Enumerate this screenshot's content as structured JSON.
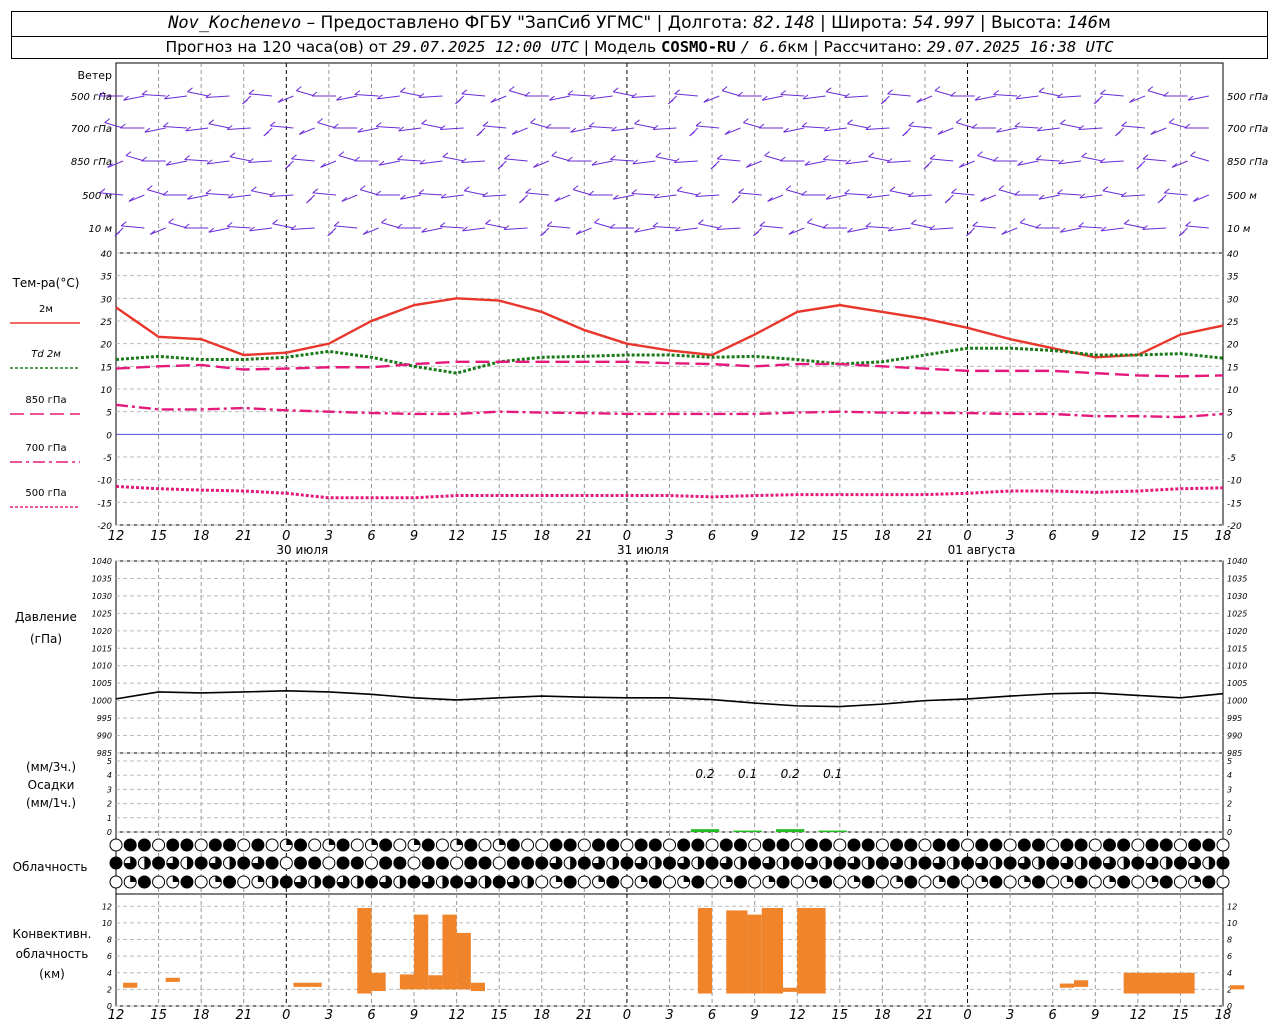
{
  "header": {
    "station": "Nov_Kochenevo",
    "provider": "– Предоставлено ФГБУ \"ЗапСиб УГМС\"",
    "lon_label": "Долгота:",
    "lon": "82.148",
    "lat_label": "Широта:",
    "lat": "54.997",
    "alt_label": "Высота:",
    "alt": "146",
    "alt_unit": "м",
    "forecast_prefix": "Прогноз на 120 часа(ов) от",
    "forecast_from": "29.07.2025 12:00 UTC",
    "model_label": "Модель",
    "model": "COSMO-RU",
    "resolution": "/ 6.6",
    "resolution_unit": "км",
    "calc_label": "Рассчитано:",
    "calc_time": "29.07.2025 16:38 UTC"
  },
  "chart_data": [
    {
      "type": "wind-barbs",
      "panel_title": "Ветер",
      "levels": [
        "500 гПа",
        "700 гПа",
        "850 гПа",
        "500 м",
        "10 м"
      ]
    },
    {
      "type": "line",
      "panel_title": "Тем-ра(°C)",
      "ylim": [
        -20,
        40
      ],
      "yticks": [
        40,
        35,
        30,
        25,
        20,
        15,
        10,
        5,
        0,
        -5,
        -10,
        -15,
        -20
      ],
      "x_hours": [
        0,
        3,
        6,
        9,
        12,
        15,
        18,
        21,
        24,
        27,
        30,
        33,
        36,
        39,
        42,
        45,
        48,
        51,
        54,
        57,
        60,
        63,
        66,
        69,
        72,
        75,
        78
      ],
      "series": [
        {
          "name": "2м",
          "color": "#e8362c",
          "style": "solid",
          "values": [
            28,
            21.5,
            21,
            17.5,
            18,
            20,
            25,
            28.5,
            30,
            29.5,
            27,
            23,
            20,
            18.5,
            17.5,
            22,
            27,
            28.5,
            27,
            25.5,
            23.5,
            21,
            19,
            17,
            17.5,
            22,
            24
          ]
        },
        {
          "name": "Td 2м",
          "color": "#1a7a1a",
          "style": "dotted",
          "values": [
            16.5,
            17.2,
            16.5,
            16.5,
            17,
            18.3,
            17,
            15,
            13.5,
            16,
            17,
            17.2,
            17.5,
            17.5,
            17,
            17.2,
            16.5,
            15.5,
            16,
            17.5,
            19,
            19,
            18.5,
            17.5,
            17.5,
            17.8,
            16.8
          ]
        },
        {
          "name": "850 гПа",
          "color": "#e4197c",
          "style": "longdash",
          "values": [
            14.5,
            15,
            15.3,
            14.3,
            14.5,
            14.8,
            14.8,
            15.5,
            16,
            16,
            16,
            16,
            16,
            15.7,
            15.5,
            15,
            15.5,
            15.5,
            15,
            14.5,
            14,
            14,
            14,
            13.5,
            13,
            12.8,
            13
          ]
        },
        {
          "name": "700 гПа",
          "color": "#e4197c",
          "style": "dashdot",
          "values": [
            6.5,
            5.5,
            5.5,
            5.8,
            5.3,
            5,
            4.7,
            4.5,
            4.5,
            5,
            4.8,
            4.7,
            4.5,
            4.5,
            4.5,
            4.5,
            4.8,
            5,
            4.8,
            4.7,
            4.7,
            4.5,
            4.5,
            4,
            4,
            3.8,
            4.5
          ]
        },
        {
          "name": "500 гПа",
          "color": "#e4197c",
          "style": "dotted",
          "values": [
            -11.5,
            -12,
            -12.3,
            -12.5,
            -13,
            -14,
            -14,
            -14,
            -13.5,
            -13.5,
            -13.5,
            -13.5,
            -13.5,
            -13.5,
            -13.8,
            -13.5,
            -13.3,
            -13.3,
            -13.3,
            -13.3,
            -13,
            -12.5,
            -12.5,
            -12.8,
            -12.5,
            -12,
            -11.8
          ]
        }
      ]
    },
    {
      "type": "line",
      "panel_title": "Давление",
      "unit": "(гПа)",
      "ylim": [
        985,
        1040
      ],
      "yticks": [
        1040,
        1035,
        1030,
        1025,
        1020,
        1015,
        1010,
        1005,
        1000,
        995,
        990,
        985
      ],
      "x_hours": [
        0,
        3,
        6,
        9,
        12,
        15,
        18,
        21,
        24,
        27,
        30,
        33,
        36,
        39,
        42,
        45,
        48,
        51,
        54,
        57,
        60,
        63,
        66,
        69,
        72,
        75,
        78
      ],
      "series": [
        {
          "color": "#000000",
          "values": [
            1000.5,
            1002.5,
            1002.2,
            1002.5,
            1002.8,
            1002.5,
            1001.8,
            1000.8,
            1000.2,
            1000.8,
            1001.3,
            1001,
            1000.8,
            1000.8,
            1000.3,
            999.3,
            998.5,
            998.3,
            999,
            1000,
            1000.5,
            1001.3,
            1002,
            1002.2,
            1001.5,
            1000.8,
            1002
          ]
        }
      ]
    },
    {
      "type": "bar",
      "panel_title": "Осадки",
      "units": [
        "(мм/3ч.)",
        "(мм/1ч.)"
      ],
      "ylim": [
        0,
        5
      ],
      "yticks": [
        5,
        4,
        3,
        2,
        1,
        0
      ],
      "x_hours": [
        40,
        43,
        46,
        49
      ],
      "values": [
        0.2,
        0.1,
        0.2,
        0.1
      ],
      "labels": [
        "0.2",
        "0.1",
        "0.2",
        "0.1"
      ],
      "color": "#22bb22"
    },
    {
      "type": "symbols",
      "panel_title": "Облачность",
      "rows": 3
    },
    {
      "type": "bar",
      "panel_title": "Конвективн. облачность (км)",
      "ylim": [
        0,
        13
      ],
      "yticks": [
        12,
        10,
        8,
        6,
        4,
        2,
        0
      ],
      "color": "#f0842a",
      "bars": [
        {
          "start": 0.5,
          "end": 1.5,
          "base": 2.2,
          "top": 2.8
        },
        {
          "start": 3.5,
          "end": 4.5,
          "base": 2.9,
          "top": 3.4
        },
        {
          "start": 12.5,
          "end": 14.5,
          "base": 2.3,
          "top": 2.8
        },
        {
          "start": 17,
          "end": 18,
          "base": 1.5,
          "top": 11.8
        },
        {
          "start": 18,
          "end": 19,
          "base": 1.8,
          "top": 4
        },
        {
          "start": 20,
          "end": 21,
          "base": 2,
          "top": 3.8
        },
        {
          "start": 21,
          "end": 22,
          "base": 2,
          "top": 11
        },
        {
          "start": 22,
          "end": 23,
          "base": 2,
          "top": 3.7
        },
        {
          "start": 23,
          "end": 24,
          "base": 2,
          "top": 11
        },
        {
          "start": 24,
          "end": 25,
          "base": 2,
          "top": 8.8
        },
        {
          "start": 25,
          "end": 26,
          "base": 1.8,
          "top": 2.8
        },
        {
          "start": 41,
          "end": 42,
          "base": 1.5,
          "top": 11.8
        },
        {
          "start": 43,
          "end": 44.5,
          "base": 1.5,
          "top": 11.5
        },
        {
          "start": 44.5,
          "end": 45.5,
          "base": 1.5,
          "top": 11
        },
        {
          "start": 45.5,
          "end": 47,
          "base": 1.5,
          "top": 11.8
        },
        {
          "start": 47,
          "end": 48,
          "base": 1.7,
          "top": 2.2
        },
        {
          "start": 48,
          "end": 50,
          "base": 1.5,
          "top": 11.8
        },
        {
          "start": 66.5,
          "end": 67.5,
          "base": 2.2,
          "top": 2.7
        },
        {
          "start": 67.5,
          "end": 68.5,
          "base": 2.3,
          "top": 3.1
        },
        {
          "start": 71,
          "end": 76,
          "base": 1.5,
          "top": 4
        },
        {
          "start": 78.5,
          "end": 79.5,
          "base": 2,
          "top": 2.5
        }
      ]
    }
  ],
  "x_axis": {
    "hour_labels": [
      "12",
      "15",
      "18",
      "21",
      "0",
      "3",
      "6",
      "9",
      "12",
      "15",
      "18",
      "21",
      "0",
      "3",
      "6",
      "9",
      "12",
      "15",
      "18",
      "21",
      "0",
      "3",
      "6",
      "9",
      "12",
      "15",
      "18"
    ],
    "date_labels": [
      "30 июля",
      "31 июля",
      "01 августа"
    ]
  }
}
